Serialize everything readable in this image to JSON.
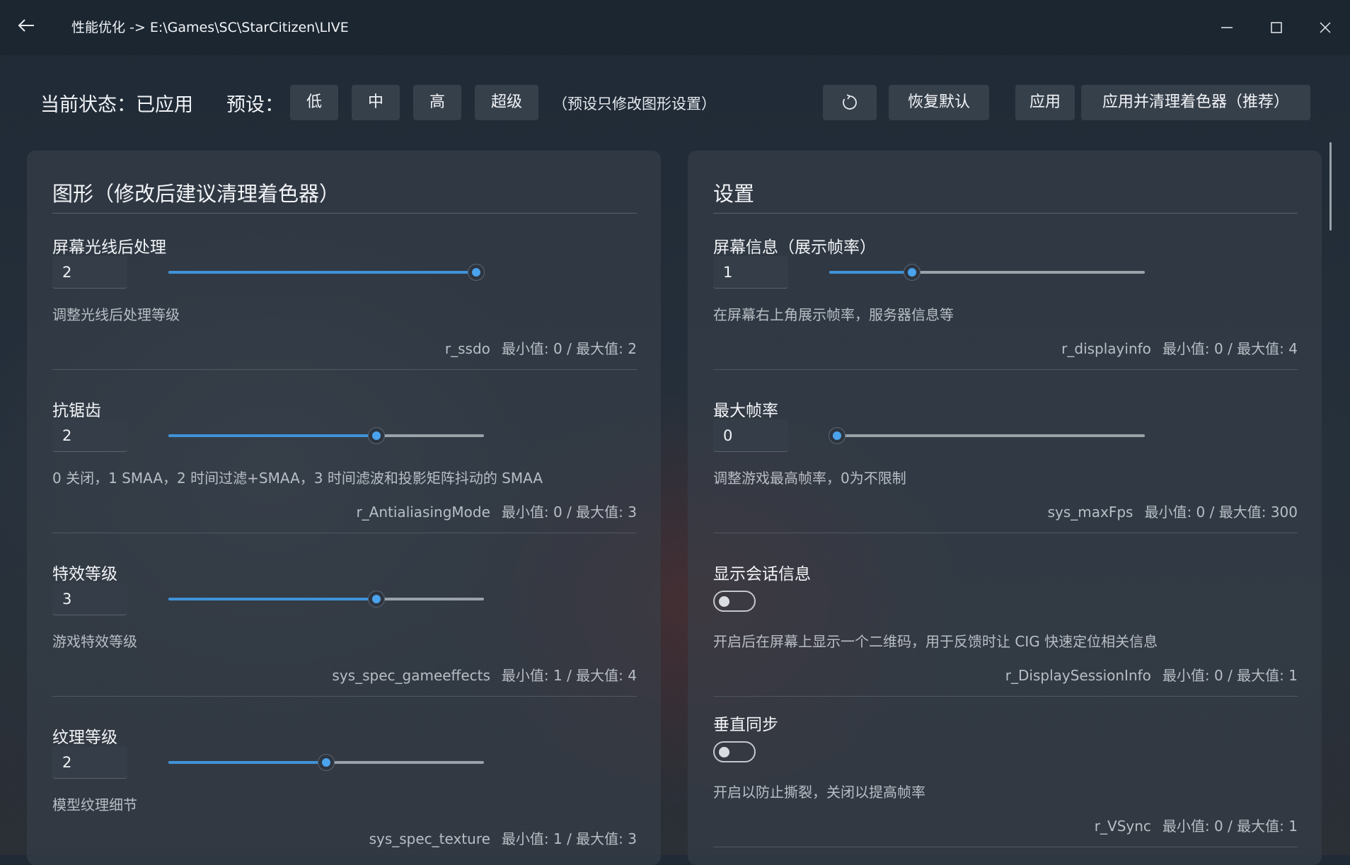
{
  "window": {
    "title": "性能优化 -> E:\\Games\\SC\\StarCitizen\\LIVE"
  },
  "toolbar": {
    "status_label": "当前状态：已应用",
    "preset_label": "预设：",
    "presets": [
      "低",
      "中",
      "高",
      "超级"
    ],
    "preset_note": "（预设只修改图形设置）",
    "refresh_icon": "refresh-icon",
    "restore_default": "恢复默认",
    "apply": "应用",
    "apply_and_clear": "应用并清理着色器（推荐）"
  },
  "graphics": {
    "title": "图形（修改后建议清理着色器）",
    "settings": [
      {
        "name": "屏幕光线后处理",
        "value": "2",
        "min": 0,
        "max": 2,
        "description": "调整光线后处理等级",
        "key": "r_ssdo",
        "range_text": "最小值: 0 / 最大值: 2"
      },
      {
        "name": "抗锯齿",
        "value": "2",
        "min": 0,
        "max": 3,
        "description": "0 关闭，1 SMAA，2 时间过滤+SMAA，3 时间滤波和投影矩阵抖动的 SMAA",
        "key": "r_AntialiasingMode",
        "range_text": "最小值: 0 / 最大值: 3"
      },
      {
        "name": "特效等级",
        "value": "3",
        "min": 1,
        "max": 4,
        "description": "游戏特效等级",
        "key": "sys_spec_gameeffects",
        "range_text": "最小值: 1 / 最大值: 4"
      },
      {
        "name": "纹理等级",
        "value": "2",
        "min": 1,
        "max": 3,
        "description": "模型纹理细节",
        "key": "sys_spec_texture",
        "range_text": "最小值: 1 / 最大值: 3"
      }
    ]
  },
  "settings": {
    "title": "设置",
    "items": [
      {
        "name": "屏幕信息（展示帧率）",
        "value": "1",
        "min": 0,
        "max": 4,
        "description": "在屏幕右上角展示帧率，服务器信息等",
        "key": "r_displayinfo",
        "range_text": "最小值: 0 / 最大值: 4"
      },
      {
        "name": "最大帧率",
        "value": "0",
        "min": 0,
        "max": 300,
        "description": "调整游戏最高帧率，0为不限制",
        "key": "sys_maxFps",
        "range_text": "最小值: 0 / 最大值: 300"
      },
      {
        "name": "显示会话信息",
        "toggle": false,
        "description": "开启后在屏幕上显示一个二维码，用于反馈时让 CIG 快速定位相关信息",
        "key": "r_DisplaySessionInfo",
        "range_text": "最小值: 0 / 最大值: 1"
      },
      {
        "name": "垂直同步",
        "toggle": false,
        "description": "开启以防止撕裂，关闭以提高帧率",
        "key": "r_VSync",
        "range_text": "最小值: 0 / 最大值: 1"
      }
    ]
  },
  "colors": {
    "accent": "#3f93d8",
    "background": "#1f2a36",
    "card": "#38414b",
    "button": "#36404b"
  }
}
